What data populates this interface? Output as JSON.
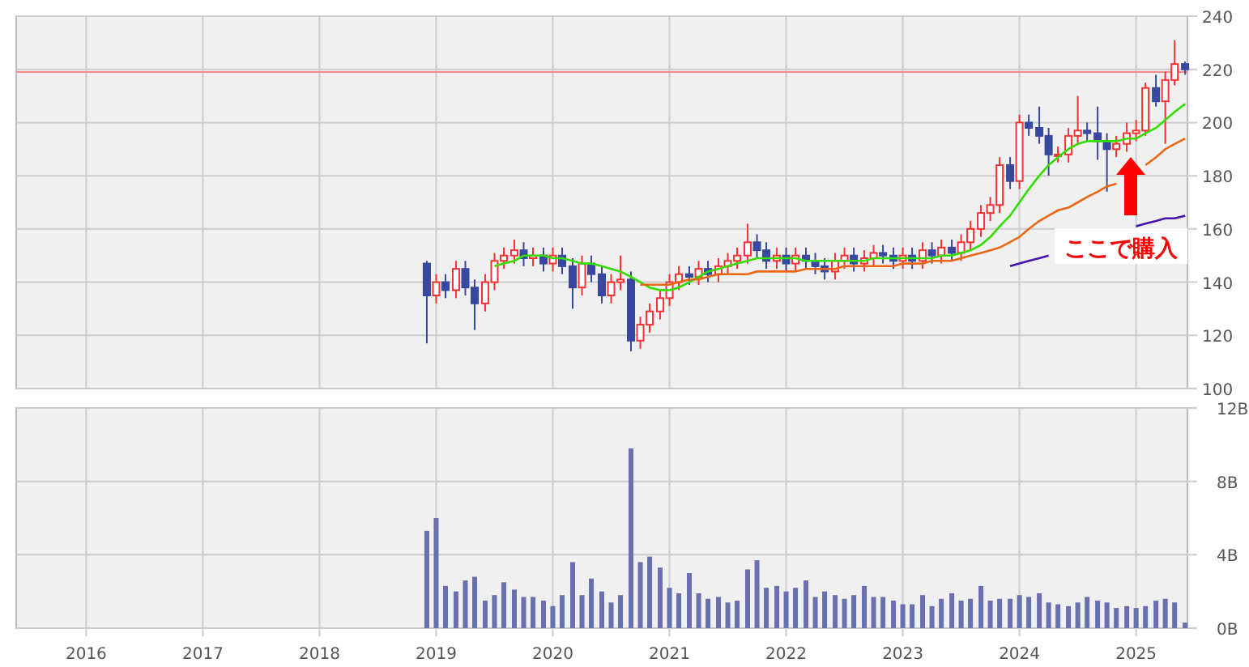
{
  "price_chart": {
    "chart_data": {
      "type": "candlestick",
      "grid": true,
      "xlim": [
        2015.4,
        2025.44
      ],
      "ylim": [
        100,
        240
      ],
      "yticks": [
        100,
        120,
        140,
        160,
        180,
        200,
        220,
        240
      ],
      "x": [
        2018.92,
        2019,
        2019.08,
        2019.17,
        2019.25,
        2019.33,
        2019.42,
        2019.5,
        2019.58,
        2019.67,
        2019.75,
        2019.83,
        2019.92,
        2020,
        2020.08,
        2020.17,
        2020.25,
        2020.33,
        2020.42,
        2020.5,
        2020.58,
        2020.67,
        2020.75,
        2020.83,
        2020.92,
        2021,
        2021.08,
        2021.17,
        2021.25,
        2021.33,
        2021.42,
        2021.5,
        2021.58,
        2021.67,
        2021.75,
        2021.83,
        2021.92,
        2022,
        2022.08,
        2022.17,
        2022.25,
        2022.33,
        2022.42,
        2022.5,
        2022.58,
        2022.67,
        2022.75,
        2022.83,
        2022.92,
        2023,
        2023.08,
        2023.17,
        2023.25,
        2023.33,
        2023.42,
        2023.5,
        2023.58,
        2023.67,
        2023.75,
        2023.83,
        2023.92,
        2024,
        2024.08,
        2024.17,
        2024.25,
        2024.33,
        2024.42,
        2024.5,
        2024.58,
        2024.67,
        2024.75,
        2024.83,
        2024.92,
        2025,
        2025.08,
        2025.17,
        2025.25,
        2025.33,
        2025.42
      ],
      "ohlc": [
        [
          147,
          148,
          117,
          135
        ],
        [
          135,
          143,
          132,
          140
        ],
        [
          140,
          143,
          134,
          137
        ],
        [
          137,
          148,
          134,
          145
        ],
        [
          145,
          148,
          135,
          138
        ],
        [
          138,
          141,
          122,
          132
        ],
        [
          132,
          143,
          129,
          140
        ],
        [
          140,
          151,
          137,
          148
        ],
        [
          148,
          153,
          145,
          150
        ],
        [
          150,
          156,
          147,
          152
        ],
        [
          152,
          155,
          146,
          149
        ],
        [
          149,
          153,
          146,
          150
        ],
        [
          150,
          153,
          144,
          147
        ],
        [
          147,
          153,
          144,
          150
        ],
        [
          150,
          153,
          143,
          146
        ],
        [
          146,
          149,
          130,
          138
        ],
        [
          138,
          150,
          135,
          147
        ],
        [
          147,
          150,
          140,
          143
        ],
        [
          143,
          146,
          132,
          135
        ],
        [
          135,
          143,
          132,
          140
        ],
        [
          140,
          150,
          137,
          141
        ],
        [
          141,
          144,
          114,
          118
        ],
        [
          118,
          127,
          115,
          124
        ],
        [
          124,
          132,
          121,
          129
        ],
        [
          129,
          137,
          126,
          134
        ],
        [
          134,
          143,
          131,
          140
        ],
        [
          140,
          146,
          137,
          143
        ],
        [
          143,
          146,
          139,
          142
        ],
        [
          142,
          148,
          139,
          145
        ],
        [
          145,
          148,
          140,
          143
        ],
        [
          143,
          149,
          140,
          146
        ],
        [
          146,
          151,
          143,
          148
        ],
        [
          148,
          153,
          145,
          150
        ],
        [
          150,
          162,
          147,
          155
        ],
        [
          155,
          158,
          149,
          152
        ],
        [
          152,
          155,
          145,
          148
        ],
        [
          148,
          153,
          145,
          150
        ],
        [
          150,
          153,
          144,
          147
        ],
        [
          147,
          153,
          144,
          150
        ],
        [
          150,
          153,
          145,
          148
        ],
        [
          148,
          151,
          143,
          146
        ],
        [
          146,
          149,
          141,
          144
        ],
        [
          144,
          151,
          141,
          148
        ],
        [
          148,
          153,
          145,
          150
        ],
        [
          150,
          153,
          144,
          147
        ],
        [
          147,
          152,
          144,
          149
        ],
        [
          149,
          154,
          146,
          151
        ],
        [
          151,
          154,
          147,
          150
        ],
        [
          150,
          153,
          145,
          148
        ],
        [
          148,
          153,
          145,
          150
        ],
        [
          150,
          153,
          145,
          148
        ],
        [
          148,
          155,
          145,
          152
        ],
        [
          152,
          155,
          147,
          150
        ],
        [
          150,
          156,
          147,
          153
        ],
        [
          153,
          156,
          148,
          151
        ],
        [
          151,
          158,
          148,
          155
        ],
        [
          155,
          163,
          152,
          160
        ],
        [
          160,
          169,
          157,
          166
        ],
        [
          166,
          172,
          163,
          169
        ],
        [
          169,
          187,
          166,
          184
        ],
        [
          184,
          187,
          175,
          178
        ],
        [
          178,
          203,
          175,
          200
        ],
        [
          200,
          203,
          195,
          198
        ],
        [
          198,
          206,
          192,
          195
        ],
        [
          195,
          198,
          180,
          188
        ],
        [
          188,
          191,
          185,
          188
        ],
        [
          188,
          198,
          185,
          195
        ],
        [
          195,
          210,
          192,
          197
        ],
        [
          197,
          200,
          193,
          196
        ],
        [
          196,
          206,
          186,
          193
        ],
        [
          193,
          196,
          174,
          190
        ],
        [
          190,
          195,
          187,
          192
        ],
        [
          192,
          200,
          189,
          196
        ],
        [
          196,
          201,
          193,
          197
        ],
        [
          197,
          215,
          195,
          213
        ],
        [
          213,
          218,
          206,
          208
        ],
        [
          208,
          219,
          192,
          216
        ],
        [
          216,
          231,
          214,
          222
        ],
        [
          222,
          223,
          218,
          220
        ]
      ],
      "series": [
        {
          "type": "line",
          "color": "#33dd00",
          "values": [
            null,
            null,
            null,
            null,
            null,
            null,
            null,
            146,
            147,
            148,
            150,
            150,
            150,
            149,
            149,
            148,
            147,
            147,
            146,
            145,
            144,
            142,
            140,
            138,
            137,
            137,
            138,
            140,
            142,
            144,
            145,
            146,
            147,
            148,
            149,
            149,
            149,
            149,
            149,
            148,
            148,
            148,
            148,
            148,
            148,
            148,
            149,
            149,
            149,
            149,
            149,
            149,
            149,
            150,
            150,
            151,
            152,
            154,
            157,
            161,
            165,
            170,
            175,
            180,
            184,
            187,
            190,
            192,
            193,
            193,
            193,
            193,
            194,
            194,
            196,
            198,
            201,
            204,
            207
          ]
        },
        {
          "type": "line",
          "color": "#ee6611",
          "values": [
            null,
            null,
            null,
            null,
            null,
            null,
            null,
            null,
            null,
            null,
            null,
            null,
            null,
            null,
            null,
            null,
            null,
            null,
            null,
            null,
            null,
            null,
            139,
            139,
            139,
            139,
            140,
            141,
            141,
            142,
            143,
            143,
            143,
            143,
            144,
            144,
            144,
            144,
            144,
            145,
            145,
            145,
            145,
            146,
            146,
            146,
            146,
            146,
            146,
            147,
            147,
            147,
            148,
            148,
            148,
            149,
            150,
            151,
            152,
            153,
            155,
            157,
            160,
            163,
            165,
            167,
            168,
            170,
            172,
            174,
            176,
            177,
            null,
            null,
            184,
            187,
            190,
            192,
            194
          ]
        },
        {
          "type": "line",
          "color": "#4411aa",
          "values": [
            null,
            null,
            null,
            null,
            null,
            null,
            null,
            null,
            null,
            null,
            null,
            null,
            null,
            null,
            null,
            null,
            null,
            null,
            null,
            null,
            null,
            null,
            null,
            null,
            null,
            null,
            null,
            null,
            null,
            null,
            null,
            null,
            null,
            null,
            null,
            null,
            null,
            null,
            null,
            null,
            null,
            null,
            null,
            null,
            null,
            null,
            null,
            null,
            null,
            null,
            null,
            null,
            null,
            null,
            null,
            null,
            null,
            null,
            null,
            null,
            146,
            147,
            148,
            149,
            150,
            null,
            null,
            null,
            null,
            null,
            null,
            null,
            null,
            161,
            162,
            163,
            164,
            164,
            165
          ]
        }
      ],
      "ref_lines": [
        {
          "axis": "y",
          "value": 219
        }
      ],
      "annotations": [
        "ここで購入"
      ]
    }
  },
  "volume_chart": {
    "chart_data": {
      "type": "bar",
      "grid": true,
      "xlim": [
        2015.4,
        2025.44
      ],
      "ylim": [
        0,
        12
      ],
      "yticks": [
        {
          "value": 0,
          "label": "0B"
        },
        {
          "value": 4,
          "label": "4B"
        },
        {
          "value": 8,
          "label": "8B"
        },
        {
          "value": 12,
          "label": "12B"
        }
      ],
      "xticks": [
        2016,
        2017,
        2018,
        2019,
        2020,
        2021,
        2022,
        2023,
        2024,
        2025
      ],
      "x": [
        2018.92,
        2019,
        2019.08,
        2019.17,
        2019.25,
        2019.33,
        2019.42,
        2019.5,
        2019.58,
        2019.67,
        2019.75,
        2019.83,
        2019.92,
        2020,
        2020.08,
        2020.17,
        2020.25,
        2020.33,
        2020.42,
        2020.5,
        2020.58,
        2020.67,
        2020.75,
        2020.83,
        2020.92,
        2021,
        2021.08,
        2021.17,
        2021.25,
        2021.33,
        2021.42,
        2021.5,
        2021.58,
        2021.67,
        2021.75,
        2021.83,
        2021.92,
        2022,
        2022.08,
        2022.17,
        2022.25,
        2022.33,
        2022.42,
        2022.5,
        2022.58,
        2022.67,
        2022.75,
        2022.83,
        2022.92,
        2023,
        2023.08,
        2023.17,
        2023.25,
        2023.33,
        2023.42,
        2023.5,
        2023.58,
        2023.67,
        2023.75,
        2023.83,
        2023.92,
        2024,
        2024.08,
        2024.17,
        2024.25,
        2024.33,
        2024.42,
        2024.5,
        2024.58,
        2024.67,
        2024.75,
        2024.83,
        2024.92,
        2025,
        2025.08,
        2025.17,
        2025.25,
        2025.33,
        2025.42
      ],
      "series": [
        {
          "color": "#6870b0",
          "values": [
            5.3,
            6.0,
            2.3,
            2.0,
            2.6,
            2.8,
            1.5,
            1.8,
            2.5,
            2.1,
            1.7,
            1.7,
            1.5,
            1.2,
            1.8,
            3.6,
            1.8,
            2.7,
            2.0,
            1.4,
            1.8,
            9.8,
            3.6,
            3.9,
            3.3,
            2.2,
            1.9,
            3.0,
            1.9,
            1.6,
            1.7,
            1.4,
            1.5,
            3.2,
            3.7,
            2.2,
            2.3,
            2.0,
            2.2,
            2.6,
            1.7,
            2.0,
            1.8,
            1.6,
            1.8,
            2.3,
            1.7,
            1.7,
            1.5,
            1.3,
            1.3,
            1.8,
            1.2,
            1.6,
            1.9,
            1.5,
            1.6,
            2.3,
            1.5,
            1.6,
            1.6,
            1.8,
            1.7,
            1.9,
            1.4,
            1.3,
            1.2,
            1.4,
            1.7,
            1.5,
            1.4,
            1.1,
            1.2,
            1.1,
            1.2,
            1.5,
            1.6,
            1.4,
            0.3
          ]
        }
      ]
    }
  }
}
